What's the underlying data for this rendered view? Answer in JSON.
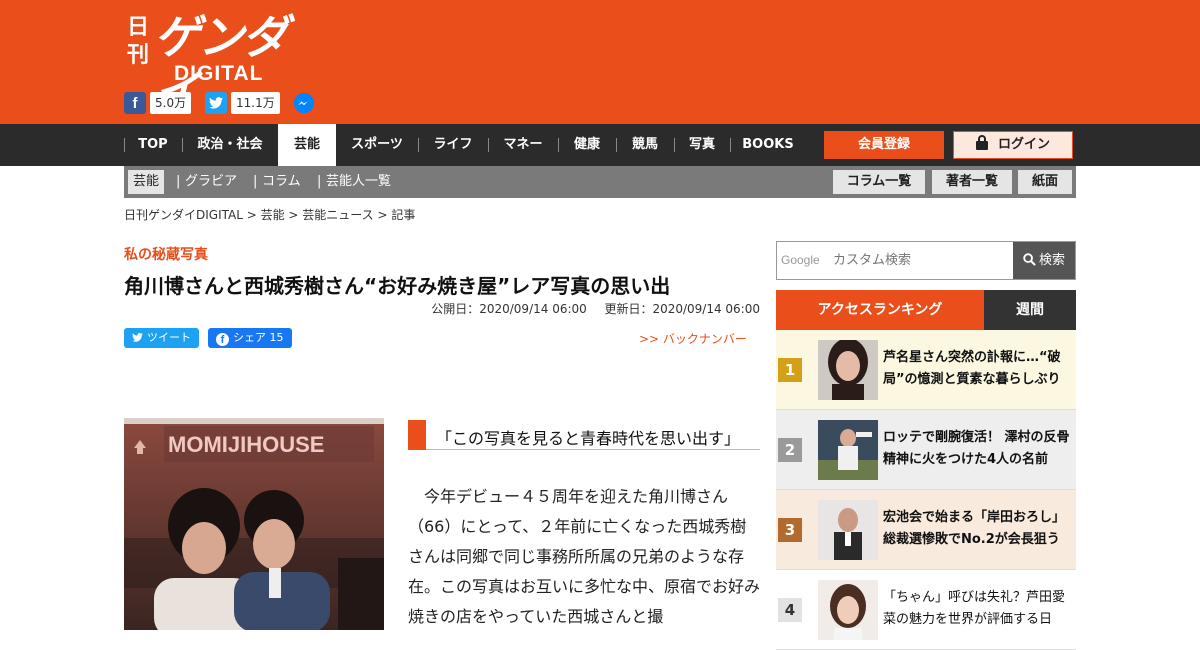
{
  "header": {
    "logo_kanji_1": "日",
    "logo_kanji_2": "刊",
    "logo_main": "ゲンダイ",
    "logo_sub": "DIGITAL",
    "social": [
      {
        "icon": "facebook-icon",
        "count": "5.0万",
        "color": "#3b5998"
      },
      {
        "icon": "twitter-icon",
        "count": "11.1万",
        "color": "#1da1f2"
      },
      {
        "icon": "messenger-icon",
        "color": "#0084ff"
      }
    ],
    "brand_color": "#e94e1b"
  },
  "nav": {
    "items": [
      "TOP",
      "政治・社会",
      "芸能",
      "スポーツ",
      "ライフ",
      "マネー",
      "健康",
      "競馬",
      "写真",
      "BOOKS"
    ],
    "active": "芸能",
    "register_label": "会員登録",
    "login_label": "ログイン"
  },
  "subnav": {
    "active": "芸能",
    "items": [
      "グラビア",
      "コラム",
      "芸能人一覧"
    ],
    "buttons": [
      "コラム一覧",
      "著者一覧",
      "紙面"
    ]
  },
  "breadcrumb": "日刊ゲンダイDIGITAL > 芸能 > 芸能ニュース > 記事",
  "article": {
    "category": "私の秘蔵写真",
    "title": "角川博さんと西城秀樹さん“お好み焼き屋”レア写真の思い出",
    "published": "公開日：2020/09/14 06:00",
    "updated": "更新日：2020/09/14 06:00",
    "tweet_label": "ツイート",
    "share_label": "シェア 15",
    "backnumber": ">> バックナンバー",
    "photo_sign": "MOMIJIHOUSE",
    "quote": "「この写真を見ると青春時代を思い出す」",
    "body": "今年デビュー４５周年を迎えた角川博さん（66）にとって、２年前に亡くなった西城秀樹さんは同郷で同じ事務所所属の兄弟のような存在。この写真はお互いに多忙な中、原宿でお好み焼きの店をやっていた西城さんと撮"
  },
  "search": {
    "google_label": "Google",
    "placeholder": "カスタム検索",
    "button": "検索"
  },
  "ranking": {
    "tab_main": "アクセスランキング",
    "tab_period": "週間",
    "items": [
      {
        "rank": "1",
        "text": "芦名星さん突然の訃報に…“破局”の憶測と質素な暮らしぶり",
        "color": "#d4a017",
        "bg": "#fbf7e1"
      },
      {
        "rank": "2",
        "text": "ロッテで剛腕復活！ 澤村の反骨精神に火をつけた4人の名前",
        "color": "#9a9a9a",
        "bg": "#eeeeee"
      },
      {
        "rank": "3",
        "text": "宏池会で始まる「岸田おろし」総裁選惨敗でNo.2が会長狙う",
        "color": "#b36a2e",
        "bg": "#f8eadc"
      },
      {
        "rank": "4",
        "text": "「ちゃん」呼びは失礼？芦田愛菜の魅力を世界が評価する日",
        "color": "#cccccc",
        "bg": "#ffffff"
      }
    ]
  }
}
